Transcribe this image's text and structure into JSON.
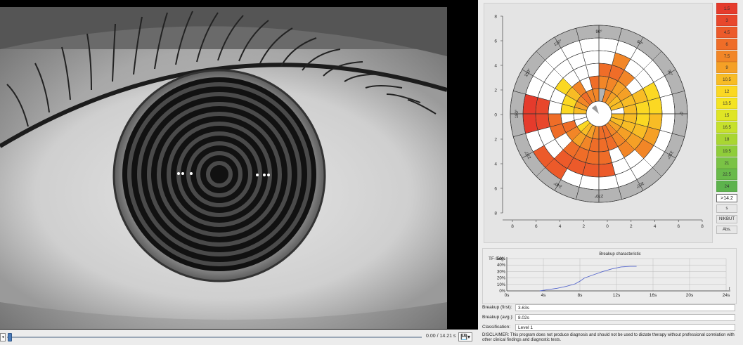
{
  "playback": {
    "play_glyph": "◂",
    "time": "0.00 / 14.21 s",
    "save_glyph": "💾▾",
    "position": 0.0
  },
  "polar_map": {
    "angle_labels": [
      "90°",
      "60°",
      "30°",
      "0°",
      "330°",
      "300°",
      "270°",
      "240°",
      "210°",
      "180°",
      "150°",
      "120°"
    ],
    "y_ticks": [
      "8",
      "6",
      "4",
      "2",
      "0",
      "2",
      "4",
      "6",
      "8"
    ],
    "x_ticks": [
      "8",
      "6",
      "4",
      "2",
      "0",
      "2",
      "4",
      "6",
      "8"
    ]
  },
  "legend": {
    "entries": [
      {
        "label": "1.5",
        "color": "#e53b2c"
      },
      {
        "label": "3",
        "color": "#e8472c"
      },
      {
        "label": "4.5",
        "color": "#ec5a2a"
      },
      {
        "label": "6",
        "color": "#ef6d28"
      },
      {
        "label": "7.5",
        "color": "#f28627"
      },
      {
        "label": "9",
        "color": "#f5a026"
      },
      {
        "label": "10.5",
        "color": "#f8bc25"
      },
      {
        "label": "12",
        "color": "#fbd823"
      },
      {
        "label": "13.5",
        "color": "#f4e422"
      },
      {
        "label": "15",
        "color": "#dfe525"
      },
      {
        "label": "16.5",
        "color": "#c6e12c"
      },
      {
        "label": "18",
        "color": "#a9d632"
      },
      {
        "label": "19.5",
        "color": "#8fcd3a"
      },
      {
        "label": "21",
        "color": "#7ac345"
      },
      {
        "label": "22.5",
        "color": "#69ba4a"
      },
      {
        "label": "24",
        "color": "#5db34d"
      }
    ],
    "threshold": ">14.2",
    "unit": "s",
    "mode_label": "NIKBUT",
    "abs_label": "Abs."
  },
  "breakup": {
    "title": "Breakup characteristic",
    "y_label": "TF-Seg.",
    "y_ticks": [
      "50%",
      "40%",
      "30%",
      "20%",
      "10%",
      "0%"
    ],
    "x_ticks": [
      "0s",
      "4s",
      "8s",
      "12s",
      "16s",
      "20s",
      "24s"
    ],
    "x_arrow": "t"
  },
  "chart_data": {
    "type": "line",
    "title": "Breakup characteristic",
    "ylabel": "TF-Seg.",
    "xlabel": "",
    "ylim": [
      0,
      50
    ],
    "xlim": [
      0,
      24
    ],
    "series": [
      {
        "x": [
          3.6,
          4.5,
          5.5,
          6.5,
          7.5,
          8.0,
          8.5,
          9.5,
          10.5,
          11.5,
          12.5,
          13.5,
          14.2
        ],
        "values": [
          0,
          2,
          4,
          7,
          11,
          15,
          20,
          25,
          30,
          34,
          37,
          38,
          38
        ]
      }
    ]
  },
  "fields": {
    "breakup_first_label": "Breakup (first):",
    "breakup_first_value": "3.63s",
    "breakup_avg_label": "Breakup (avg.):",
    "breakup_avg_value": "8.02s",
    "classification_label": "Classification:",
    "classification_value": "Level 1"
  },
  "disclaimer": "DISCLAIMER: This program does not produce diagnosis and should not be used to dictate therapy without professional correlation with other clinical findings and diagnostic tests."
}
